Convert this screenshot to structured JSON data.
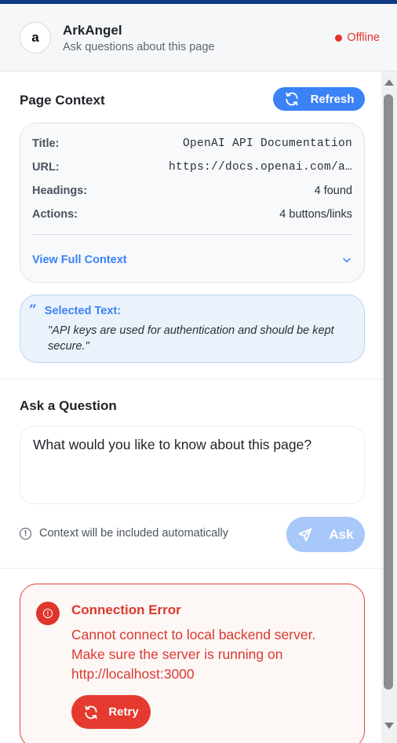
{
  "header": {
    "avatar_letter": "a",
    "app_name": "ArkAngel",
    "subtitle": "Ask questions about this page",
    "status": "Offline"
  },
  "page_context": {
    "title": "Page Context",
    "refresh_label": "Refresh",
    "rows": [
      {
        "label": "Title:",
        "value": "OpenAI API Documentation"
      },
      {
        "label": "URL:",
        "value": "https://docs.openai.com/a…"
      },
      {
        "label": "Headings:",
        "value": "4 found"
      },
      {
        "label": "Actions:",
        "value": "4 buttons/links"
      }
    ],
    "view_full_label": "View Full Context"
  },
  "selected_text": {
    "label": "Selected Text:",
    "text": "\"API keys are used for authentication and should be kept secure.\""
  },
  "ask": {
    "title": "Ask a Question",
    "placeholder": "What would you like to know about this page?",
    "hint": "Context will be included automatically",
    "ask_label": "Ask"
  },
  "error": {
    "title": "Connection Error",
    "message": "Cannot connect to local backend server. Make sure the server is running on http://localhost:3000",
    "retry_label": "Retry"
  },
  "colors": {
    "accent": "#3b82f6",
    "error": "#e0352b",
    "topbar": "#0d3a82"
  }
}
